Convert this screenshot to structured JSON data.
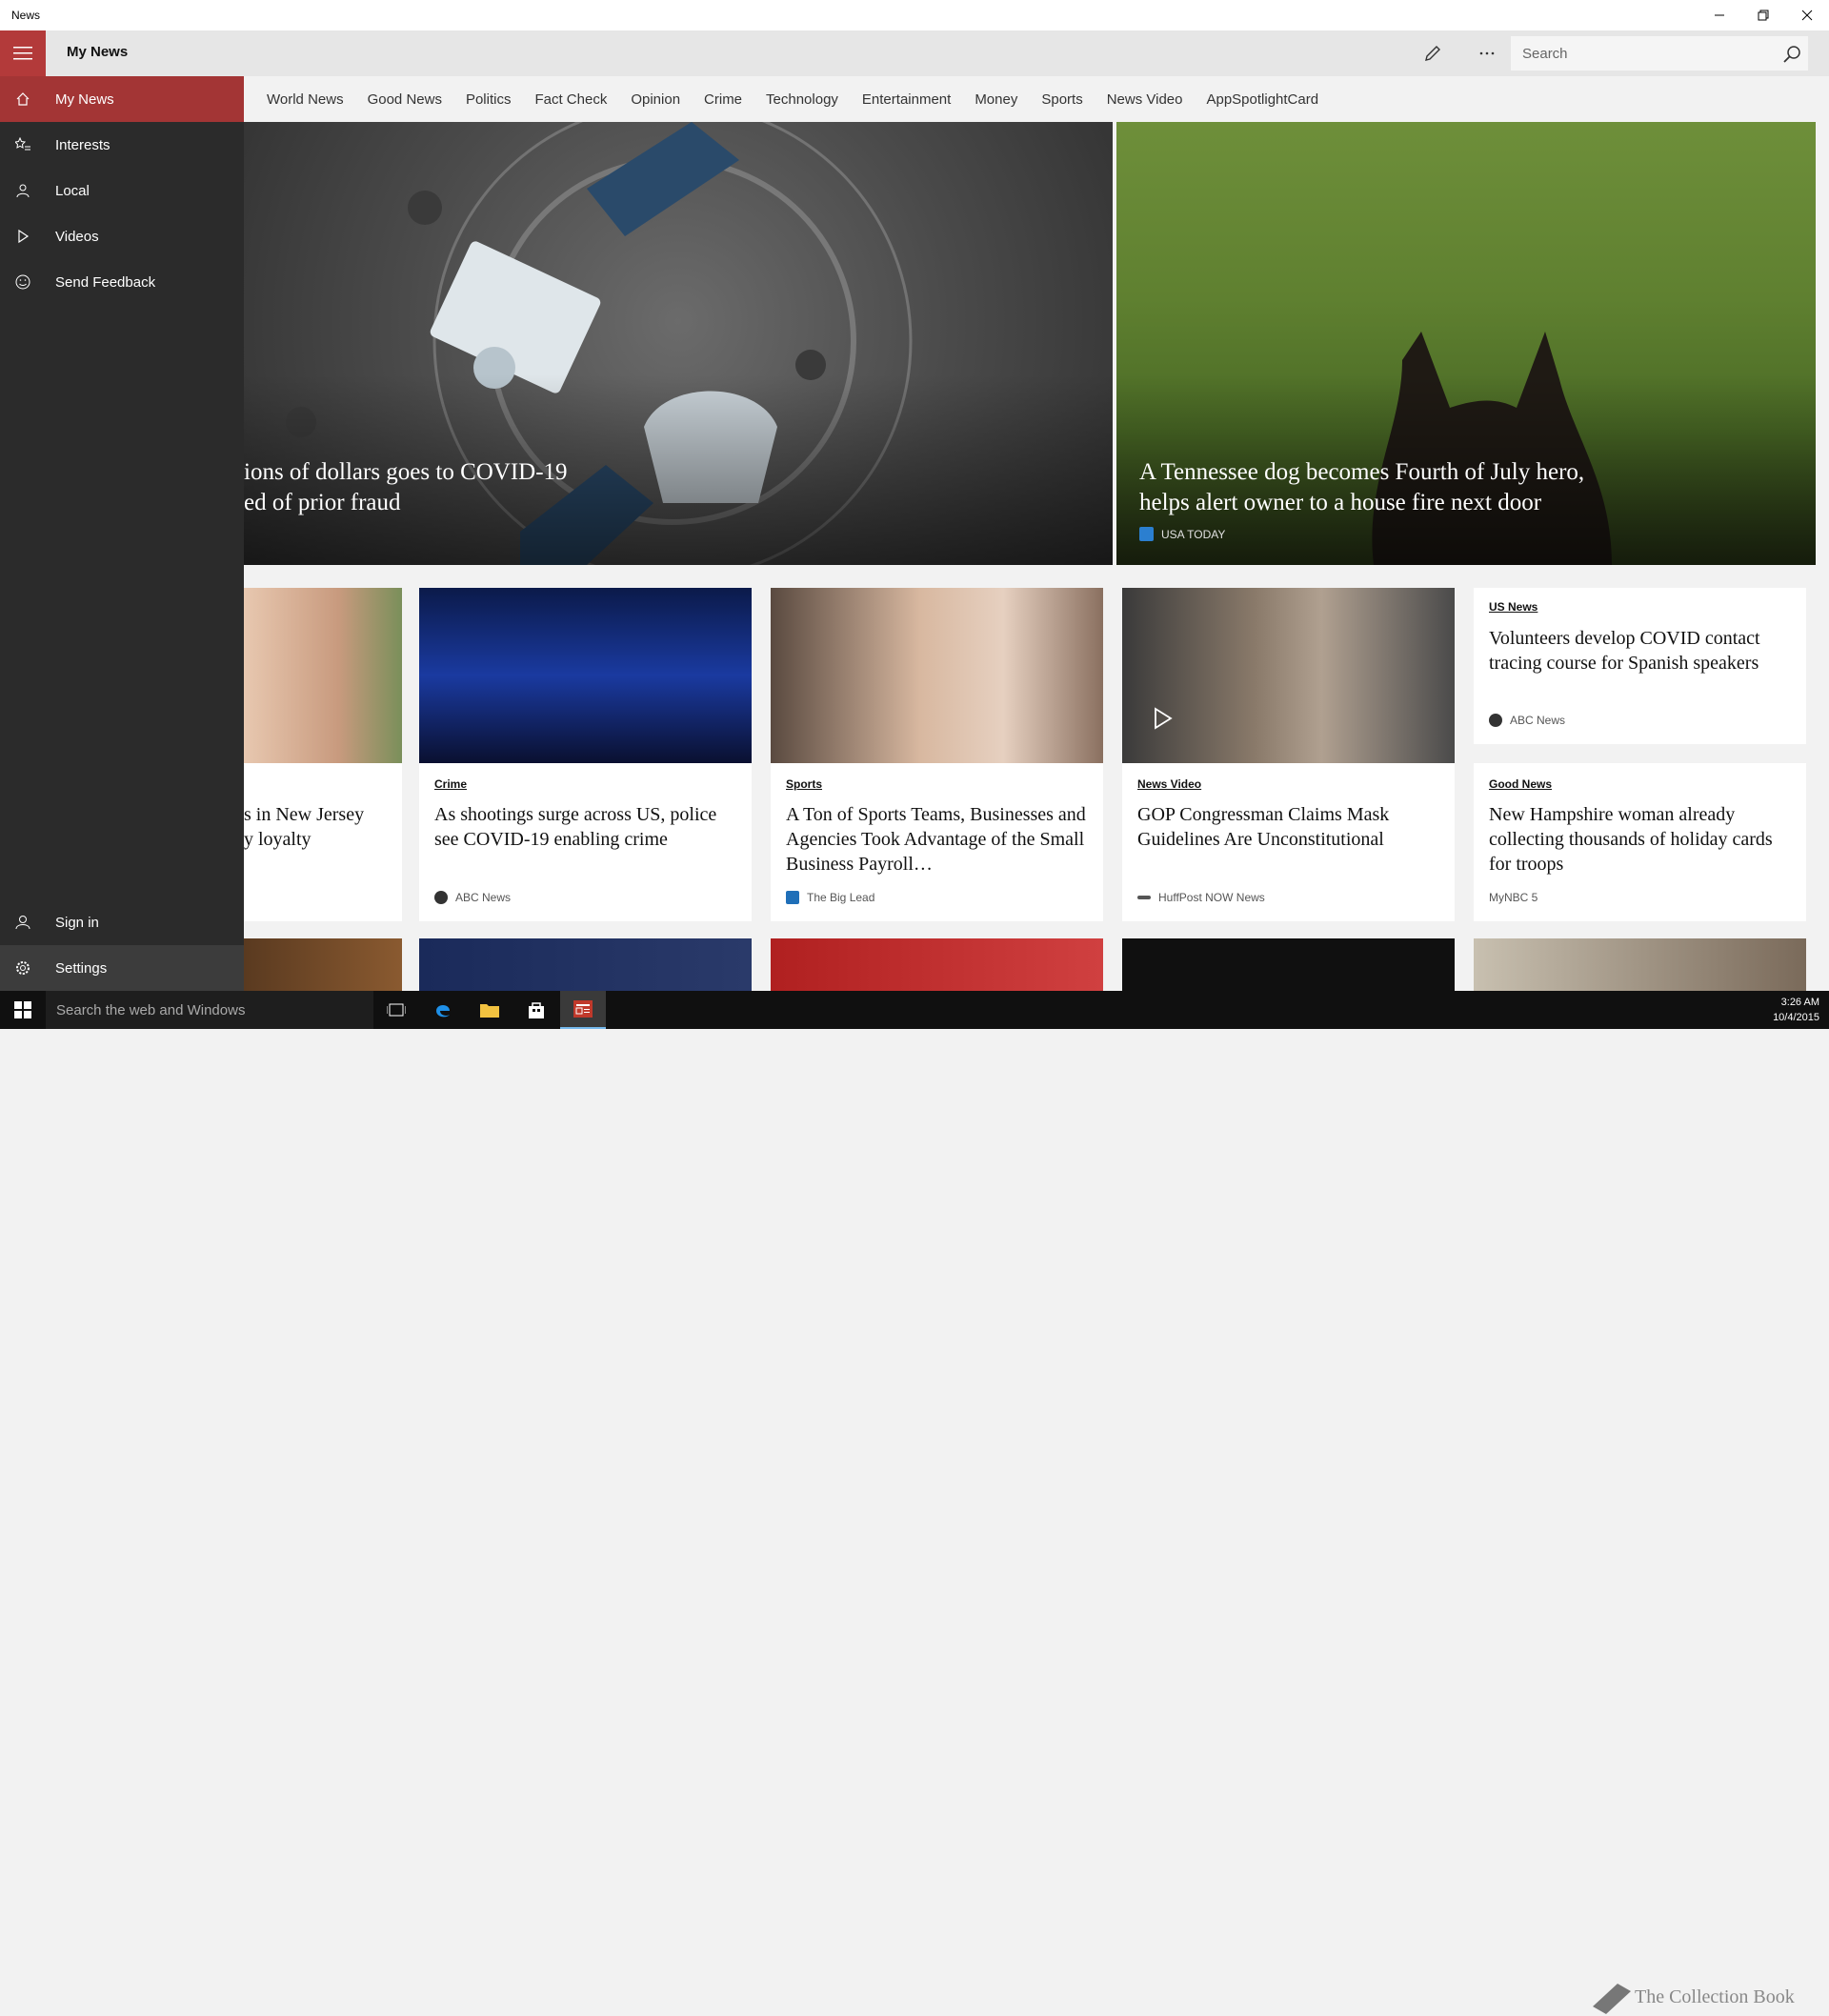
{
  "window": {
    "title": "News"
  },
  "header": {
    "page_title": "My News",
    "search_placeholder": "Search"
  },
  "sidebar": {
    "items": [
      {
        "label": "My News",
        "icon": "home-icon"
      },
      {
        "label": "Interests",
        "icon": "star-list-icon"
      },
      {
        "label": "Local",
        "icon": "person-pin-icon"
      },
      {
        "label": "Videos",
        "icon": "play-icon"
      },
      {
        "label": "Send Feedback",
        "icon": "smiley-icon"
      }
    ],
    "bottom": [
      {
        "label": "Sign in",
        "icon": "person-icon"
      },
      {
        "label": "Settings",
        "icon": "gear-icon"
      }
    ]
  },
  "categories": [
    "World News",
    "Good News",
    "Politics",
    "Fact Check",
    "Opinion",
    "Crime",
    "Technology",
    "Entertainment",
    "Money",
    "Sports",
    "News Video",
    "AppSpotlightCard"
  ],
  "hero": {
    "left": {
      "title_line1": "ions of dollars goes to COVID-19",
      "title_line2": "ed of prior fraud"
    },
    "right": {
      "title_line1": "A Tennessee dog becomes Fourth of July hero,",
      "title_line2": "helps alert owner to a house fire next door",
      "source": "USA TODAY"
    }
  },
  "cards": {
    "partial": {
      "title_line1": "s in New Jersey",
      "title_line2": "y loyalty"
    },
    "crime": {
      "category": "Crime",
      "title": "As shootings surge across US, police see COVID-19 enabling crime",
      "source": "ABC News"
    },
    "sports": {
      "category": "Sports",
      "title": "A Ton of Sports Teams, Businesses and Agencies Took Advantage of the Small Business Payroll…",
      "source": "The Big Lead"
    },
    "video": {
      "category": "News Video",
      "title": "GOP Congressman Claims Mask Guidelines Are Unconstitutional",
      "source": "HuffPost NOW News"
    },
    "us_news": {
      "category": "US News",
      "title": "Volunteers develop COVID contact tracing course for Spanish speakers",
      "source": "ABC News"
    },
    "good_news": {
      "category": "Good News",
      "title": "New Hampshire woman already collecting thousands of holiday cards for troops",
      "source": "MyNBC 5"
    }
  },
  "taskbar": {
    "search_placeholder": "Search the web and Windows",
    "time": "3:26 AM",
    "date": "10/4/2015",
    "watermark": "The Collection Book"
  },
  "colors": {
    "accent": "#b33a3a",
    "sidebar_bg": "#2b2b2b",
    "taskbar_bg": "#101010"
  }
}
